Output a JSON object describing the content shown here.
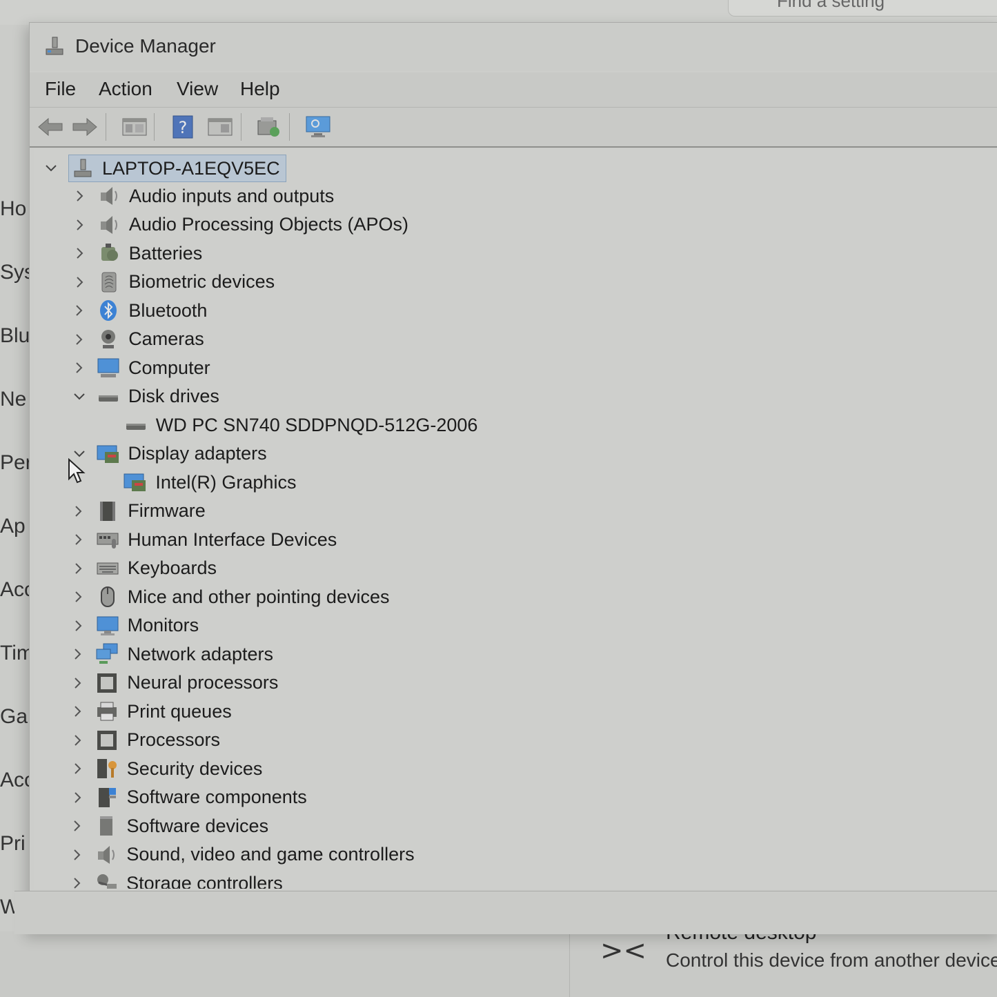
{
  "background": {
    "search_placeholder": "Find a setting",
    "left_nav": [
      "Ho",
      "Sys",
      "Blu",
      "Ne",
      "Per",
      "Ap",
      "Acc",
      "Tim",
      "Gai",
      "Acc",
      "Pri",
      "Wi"
    ],
    "remote_desktop_title": "Remote desktop",
    "remote_desktop_desc": "Control this device from another device"
  },
  "window": {
    "title": "Device Manager",
    "menu": [
      "File",
      "Action",
      "View",
      "Help"
    ],
    "toolbar": [
      "back-icon",
      "forward-icon",
      "properties-icon",
      "help-icon",
      "view-icon",
      "update-driver-icon",
      "monitor-scan-icon"
    ]
  },
  "tree": {
    "root": "LAPTOP-A1EQV5EC",
    "items": [
      {
        "label": "Audio inputs and outputs",
        "icon": "speaker-icon",
        "expanded": false
      },
      {
        "label": "Audio Processing Objects (APOs)",
        "icon": "speaker-icon",
        "expanded": false
      },
      {
        "label": "Batteries",
        "icon": "battery-icon",
        "expanded": false
      },
      {
        "label": "Biometric devices",
        "icon": "fingerprint-icon",
        "expanded": false
      },
      {
        "label": "Bluetooth",
        "icon": "bluetooth-icon",
        "expanded": false
      },
      {
        "label": "Cameras",
        "icon": "camera-icon",
        "expanded": false
      },
      {
        "label": "Computer",
        "icon": "computer-icon",
        "expanded": false
      },
      {
        "label": "Disk drives",
        "icon": "disk-icon",
        "expanded": true
      },
      {
        "label": "WD PC SN740 SDDPNQD-512G-2006",
        "icon": "disk-icon",
        "child": true
      },
      {
        "label": "Display adapters",
        "icon": "display-adapter-icon",
        "expanded": true
      },
      {
        "label": "Intel(R) Graphics",
        "icon": "display-adapter-icon",
        "child": true
      },
      {
        "label": "Firmware",
        "icon": "firmware-icon",
        "expanded": false
      },
      {
        "label": "Human Interface Devices",
        "icon": "hid-icon",
        "expanded": false
      },
      {
        "label": "Keyboards",
        "icon": "keyboard-icon",
        "expanded": false
      },
      {
        "label": "Mice and other pointing devices",
        "icon": "mouse-icon",
        "expanded": false
      },
      {
        "label": "Monitors",
        "icon": "monitor-icon",
        "expanded": false
      },
      {
        "label": "Network adapters",
        "icon": "network-icon",
        "expanded": false
      },
      {
        "label": "Neural processors",
        "icon": "chip-icon",
        "expanded": false
      },
      {
        "label": "Print queues",
        "icon": "printer-icon",
        "expanded": false
      },
      {
        "label": "Processors",
        "icon": "chip-icon",
        "expanded": false
      },
      {
        "label": "Security devices",
        "icon": "security-icon",
        "expanded": false
      },
      {
        "label": "Software components",
        "icon": "software-component-icon",
        "expanded": false
      },
      {
        "label": "Software devices",
        "icon": "software-device-icon",
        "expanded": false
      },
      {
        "label": "Sound, video and game controllers",
        "icon": "speaker-icon",
        "expanded": false
      },
      {
        "label": "Storage controllers",
        "icon": "storage-controller-icon",
        "expanded": false
      }
    ]
  },
  "colors": {
    "selection": "#b9c6d3",
    "accent_blue": "#2f7fd6"
  }
}
